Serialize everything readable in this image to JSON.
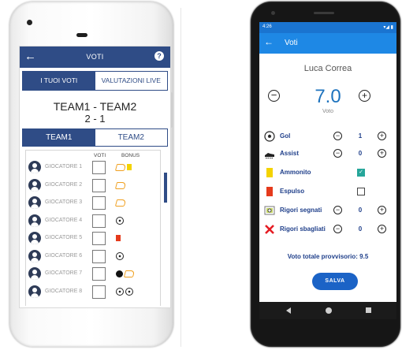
{
  "left_phone": {
    "appbar": {
      "title": "VOTI",
      "back_icon": "arrow-left-icon",
      "help_label": "?"
    },
    "top_tabs": [
      {
        "label": "I TUOI VOTI",
        "active": true
      },
      {
        "label": "VALUTAZIONI LIVE",
        "active": false
      }
    ],
    "match": {
      "title": "TEAM1 - TEAM2",
      "score": "2 - 1"
    },
    "team_tabs": [
      {
        "label": "TEAM1",
        "active": true
      },
      {
        "label": "TEAM2",
        "active": false
      }
    ],
    "columns": {
      "voti": "VOTI",
      "bonus": "BONUS"
    },
    "players": [
      {
        "name": "GIOCATORE 1",
        "bonus": [
          "assist-boot-icon",
          "yellow-card-icon"
        ]
      },
      {
        "name": "GIOCATORE 2",
        "bonus": [
          "assist-boot-icon"
        ]
      },
      {
        "name": "GIOCATORE 3",
        "bonus": [
          "assist-boot-icon"
        ]
      },
      {
        "name": "GIOCATORE 4",
        "bonus": [
          "ball-icon"
        ]
      },
      {
        "name": "GIOCATORE 5",
        "bonus": [
          "red-card-icon"
        ]
      },
      {
        "name": "GIOCATORE 6",
        "bonus": [
          "ball-icon"
        ]
      },
      {
        "name": "GIOCATORE 7",
        "bonus": [
          "own-goal-ball-icon",
          "assist-boot-icon"
        ]
      },
      {
        "name": "GIOCATORE 8",
        "bonus": [
          "ball-icon",
          "ball-icon"
        ]
      }
    ]
  },
  "right_phone": {
    "status": {
      "time": "4:26",
      "icons": "▾◢ ▮"
    },
    "appbar": {
      "title": "Voti",
      "back_icon": "arrow-left-icon"
    },
    "player_name": "Luca Correa",
    "vote": {
      "value": "7.0",
      "label": "Voto",
      "minus": "−",
      "plus": "+"
    },
    "rows": [
      {
        "label": "Gol",
        "icon": "ball-icon",
        "type": "stepper",
        "value": "1"
      },
      {
        "label": "Assist",
        "icon": "boot-icon",
        "type": "stepper",
        "value": "0"
      },
      {
        "label": "Ammonito",
        "icon": "yellow-card-icon",
        "type": "check",
        "checked": true
      },
      {
        "label": "Espulso",
        "icon": "red-card-icon",
        "type": "check",
        "checked": false
      },
      {
        "label": "Rigori segnati",
        "icon": "penalty-scored-icon",
        "type": "stepper",
        "value": "0"
      },
      {
        "label": "Rigori sbagliati",
        "icon": "penalty-missed-icon",
        "type": "stepper",
        "value": "0"
      }
    ],
    "total": {
      "label": "Voto totale provvisorio:",
      "value": "9.5"
    },
    "save_label": "SALVA"
  }
}
